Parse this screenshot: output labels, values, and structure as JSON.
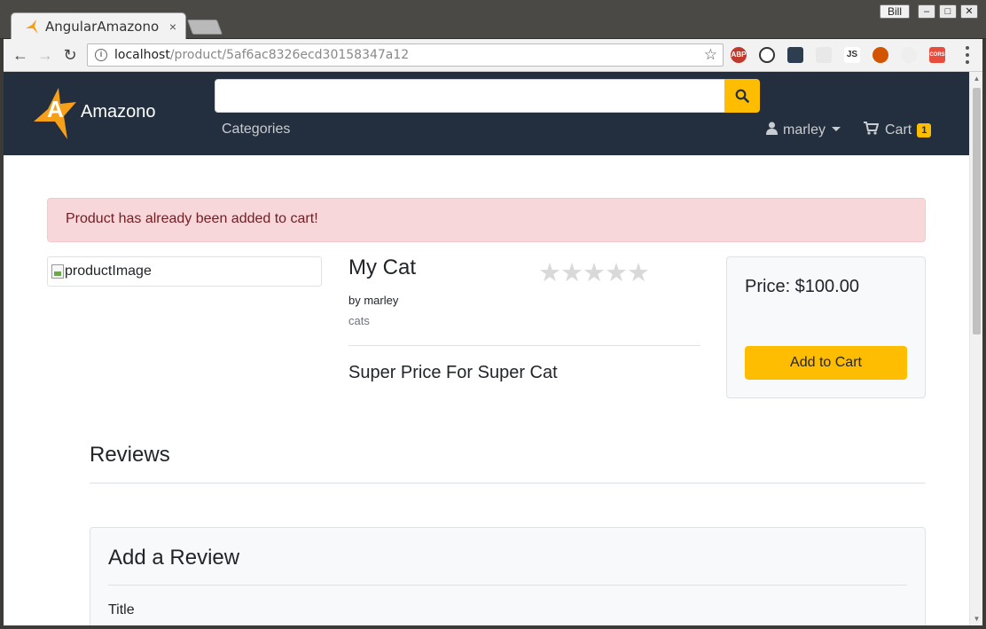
{
  "browser": {
    "tab_title": "AngularAmazono",
    "tab_close": "×",
    "user": "Bill",
    "url_host": "localhost",
    "url_path": "/product/5af6ac8326ecd30158347a12",
    "extensions": [
      "ABP",
      "JS",
      "CORS"
    ]
  },
  "navbar": {
    "brand": "Amazono",
    "search_placeholder": "",
    "categories_label": "Categories",
    "user_label": "marley",
    "cart_label": "Cart",
    "cart_count": "1"
  },
  "alert": {
    "message": "Product has already been added to cart!"
  },
  "product": {
    "image_alt": "productImage",
    "title": "My Cat",
    "author": "by marley",
    "category": "cats",
    "description": "Super Price For Super Cat",
    "rating": 0,
    "rating_max": 5,
    "price_text": "Price: $100.00",
    "add_to_cart_label": "Add to Cart"
  },
  "reviews": {
    "heading": "Reviews",
    "form_title": "Add a Review",
    "title_field_label": "Title"
  },
  "colors": {
    "navbar_bg": "#232f3e",
    "accent": "#febd00",
    "alert_bg": "#f8d7da",
    "alert_text": "#721c24"
  }
}
